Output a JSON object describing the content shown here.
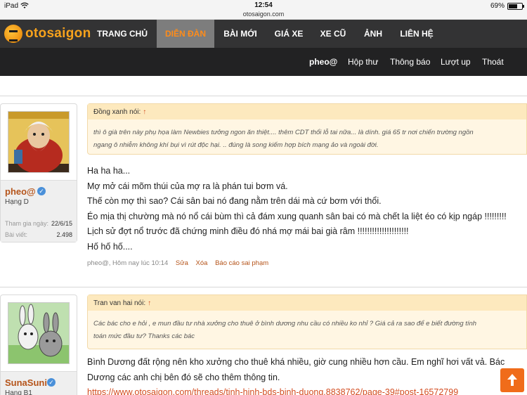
{
  "status_bar": {
    "device": "iPad",
    "wifi_icon": "wifi-icon",
    "time": "12:54",
    "url": "otosaigon.com",
    "battery": "69%",
    "battery_level": 0.69
  },
  "site": {
    "logo_text": "otosaigon",
    "accent": "#f7a21c",
    "nav_bg": "#333334"
  },
  "main_nav": [
    {
      "label": "TRANG CHỦ"
    },
    {
      "label": "DIỄN ĐÀN",
      "active": true
    },
    {
      "label": "BÀI MỚI"
    },
    {
      "label": "GIÁ XE"
    },
    {
      "label": "XE CŨ"
    },
    {
      "label": "ẢNH"
    },
    {
      "label": "LIÊN HỆ"
    }
  ],
  "sub_nav": [
    {
      "label": "pheo@"
    },
    {
      "label": "Hộp thư"
    },
    {
      "label": "Thông báo"
    },
    {
      "label": "Lượt up"
    },
    {
      "label": "Thoát"
    }
  ],
  "posts": [
    {
      "user": {
        "name": "pheo@",
        "rank": "Hạng D",
        "joined_label": "Tham gia ngày:",
        "joined": "22/6/15",
        "posts_label": "Bài viết:",
        "posts": "2.498"
      },
      "quote": {
        "author": "Đồng xanh nói:",
        "arrow": "↑",
        "lines": [
          "thì ô già trên này phụ họa làm Newbies tưởng ngon ăn thiệt.... thêm CDT thổi lỗ tai nữa... là dính. giá 65 tr nơi chiến trường ngồn",
          "ngang ô nhiễm không khí bụi vì rút độc hại. .. đúng là song kiếm hợp bích mạng ảo và ngoài đời."
        ]
      },
      "message": [
        "Ha ha ha...",
        "Mợ mở cái mõm thúi của mợ ra là phán tui bơm vá.",
        "Thế còn mợ thì sao? Cái sân bai nó đang nằm trên dái mà cứ bơm với thổi.",
        "Éo mịa thị chường mà nó nổ cái bùm thì cả đám xung quanh sân bai có mà chết la liệt éo có kịp ngáp !!!!!!!!!",
        "Lịch sử đợt nổ trước đã chứng minh điều đó nhá mợ mái bai già râm !!!!!!!!!!!!!!!!!!!!!",
        "Hố hố hố...."
      ],
      "meta": {
        "info": "pheo@, Hôm nay lúc 10:14",
        "edit": "Sửa",
        "delete": "Xóa",
        "report": "Báo cáo sai phạm"
      }
    },
    {
      "user": {
        "name": "SunaSuni",
        "rank": "Hạng B1"
      },
      "quote": {
        "author": "Tran van hai nói:",
        "arrow": "↑",
        "lines": [
          "Các bác cho e hỏi , e mun đầu tư nhà xưởng cho thuê ở bình dương nhu cầu có nhiều ko nhỉ ? Giá cả ra sao để e biết đường tính",
          "toán mức đầu tư? Thanks các bác"
        ]
      },
      "message": [
        "Bình Dương đất rộng nên kho xưởng cho thuê khá nhiều, giờ cung nhiều hơn cầu. Em nghĩ hơi vất vả. Bác",
        "Dương các anh chị bên đó sẽ cho thêm thông tin."
      ],
      "link": "https://www.otosaigon.com/threads/tinh-hinh-bds-binh-duong.8838762/page-39#post-16572799"
    }
  ]
}
